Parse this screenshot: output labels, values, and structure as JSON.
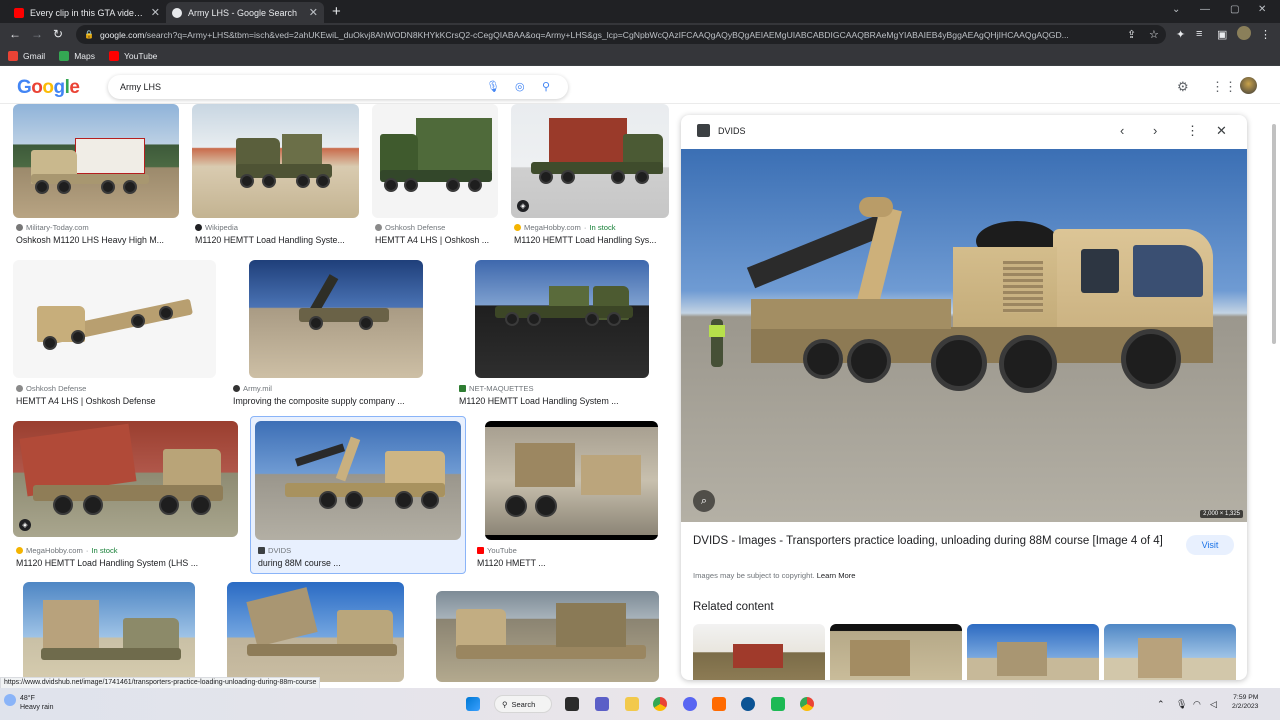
{
  "browser": {
    "tabs": [
      {
        "title": "Every clip in this GTA video is hi",
        "favicon_color": "#ff0000",
        "active": false
      },
      {
        "title": "Army LHS - Google Search",
        "favicon_color": "#e8eaed",
        "active": true
      }
    ],
    "url_host": "google.com",
    "url_path": "/search?q=Army+LHS&tbm=isch&ved=2ahUKEwiL_duOkvj8AhWODN8KHYkKCrsQ2-cCegQIABAA&oq=Army+LHS&gs_lcp=CgNpbWcQAzIFCAAQgAQyBQgAEIAEMgUIABCABDIGCAAQBRAeMgYIABAIEB4yBggAEAgQHjIHCAAQgAQGD...",
    "bookmarks": [
      {
        "label": "Gmail",
        "color": "#ea4335"
      },
      {
        "label": "Maps",
        "color": "#34a853"
      },
      {
        "label": "YouTube",
        "color": "#ff0000"
      }
    ]
  },
  "google": {
    "logo": "Google",
    "query": "Army LHS"
  },
  "results": [
    {
      "source": "Military-Today.com",
      "title": "Oshkosh M1120 LHS Heavy High M...",
      "stock": "",
      "fav": "#777777"
    },
    {
      "source": "Wikipedia",
      "title": "M1120 HEMTT Load Handling Syste...",
      "stock": "",
      "fav": "#202124"
    },
    {
      "source": "Oshkosh Defense",
      "title": "HEMTT A4 LHS | Oshkosh ...",
      "stock": "",
      "fav": "#8a8a8a"
    },
    {
      "source": "MegaHobby.com",
      "title": "M1120 HEMTT Load Handling Sys...",
      "stock": "In stock",
      "fav": "#f4b400"
    },
    {
      "source": "Oshkosh Defense",
      "title": "HEMTT A4 LHS | Oshkosh Defense",
      "stock": "",
      "fav": "#8a8a8a"
    },
    {
      "source": "Army.mil",
      "title": "Improving the composite supply company ...",
      "stock": "",
      "fav": "#333333"
    },
    {
      "source": "NET-MAQUETTES",
      "title": "M1120 HEMTT Load Handling System ...",
      "stock": "",
      "fav": "#2e7d32"
    },
    {
      "source": "MegaHobby.com",
      "title": "M1120 HEMTT Load Handling System (LHS ...",
      "stock": "In stock",
      "fav": "#f4b400"
    },
    {
      "source": "DVIDS",
      "title": "during 88M course ...",
      "stock": "",
      "fav": "#3c4043"
    },
    {
      "source": "YouTube",
      "title": "M1120 HMETT ...",
      "stock": "",
      "fav": "#ff0000"
    }
  ],
  "panel": {
    "source": "DVIDS",
    "image_dimensions": "2,000 × 1,325",
    "title": "DVIDS - Images - Transporters practice loading, unloading during 88M course [Image 4 of 4]",
    "visit_label": "Visit",
    "copyright": "Images may be subject to copyright.",
    "learn_more": "Learn More",
    "related_heading": "Related content"
  },
  "status_url": "https://www.dvidshub.net/image/1741461/transporters-practice-loading-unloading-during-88m-course",
  "taskbar": {
    "temperature": "48°F",
    "weather": "Heavy rain",
    "search_label": "Search",
    "time": "7:59 PM",
    "date": "2/2/2023"
  }
}
